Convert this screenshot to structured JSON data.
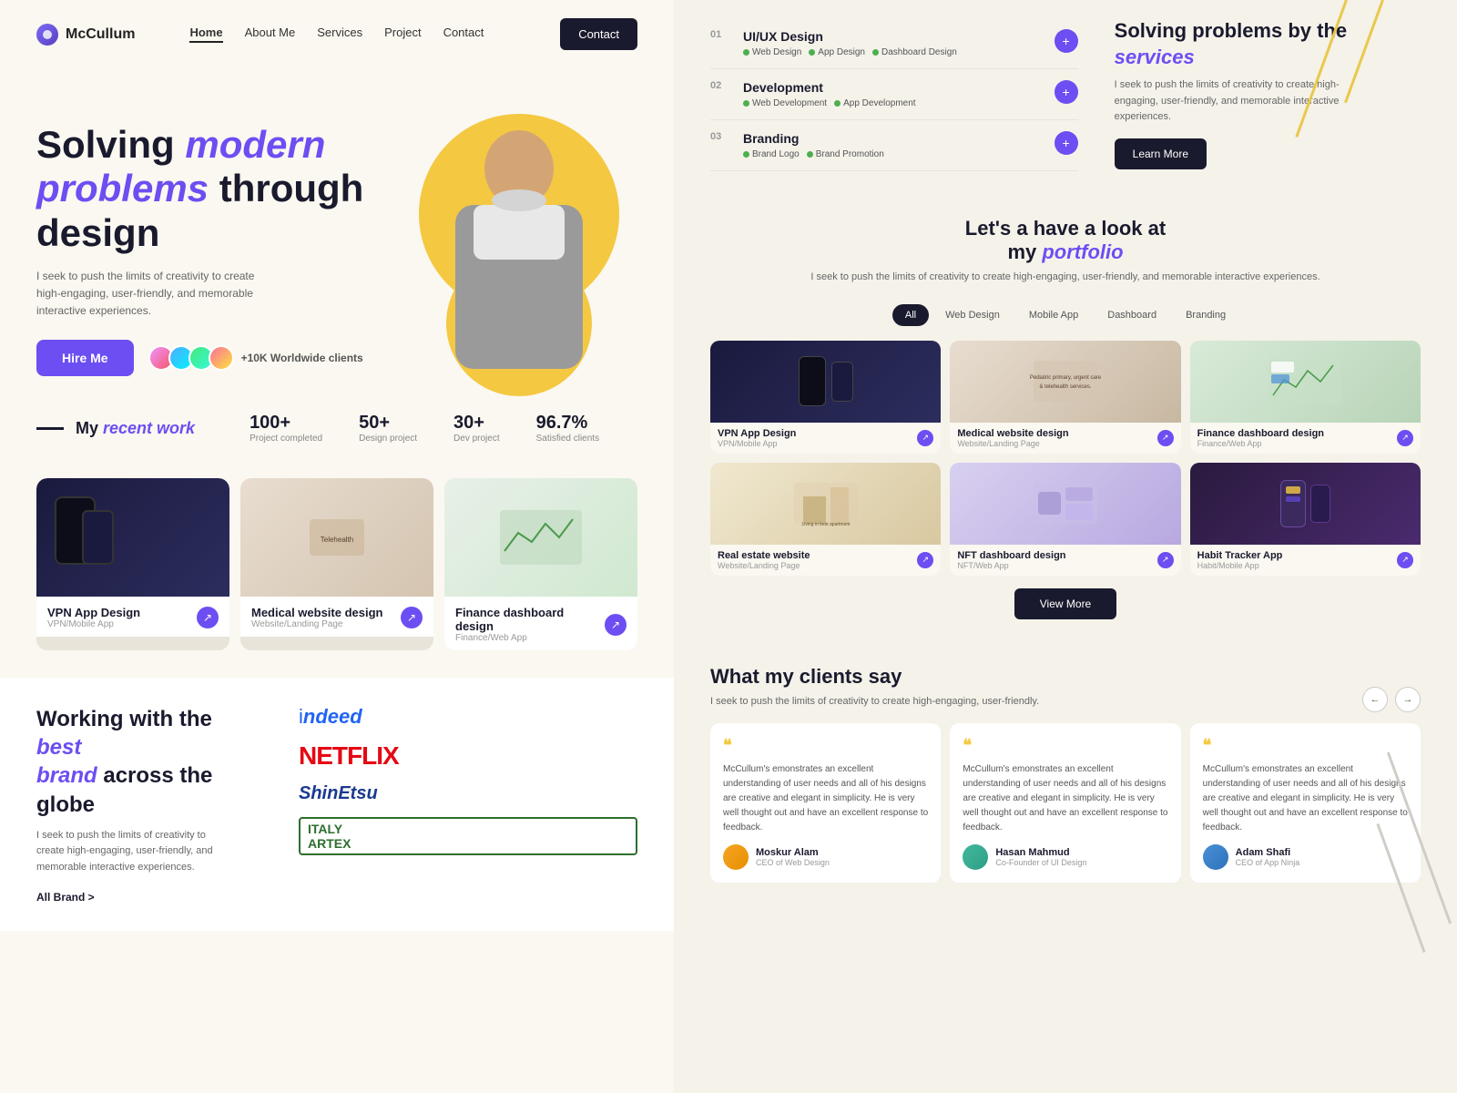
{
  "brand": {
    "logo_text": "McCullum",
    "logo_icon": "●"
  },
  "nav": {
    "links": [
      "Home",
      "About Me",
      "Services",
      "Project",
      "Contact"
    ],
    "active": "Home",
    "cta_label": "Contact"
  },
  "hero": {
    "title_prefix": "Solving ",
    "title_accent": "modern problems",
    "title_suffix": " through design",
    "description": "I seek to push the limits of creativity to create high-engaging, user-friendly, and memorable interactive experiences.",
    "hire_btn": "Hire Me",
    "clients_count": "+10K Worldwide clients"
  },
  "stats": {
    "recent_work_label": "My recent work",
    "items": [
      {
        "num": "100+",
        "label": "Project completed"
      },
      {
        "num": "50+",
        "label": "Design project"
      },
      {
        "num": "30+",
        "label": "Dev project"
      },
      {
        "num": "96.7%",
        "label": "Satisfied clients"
      }
    ]
  },
  "portfolio_cards": [
    {
      "title": "VPN App Design",
      "sub": "VPN/Mobile App",
      "type": "vpn"
    },
    {
      "title": "Medical website design",
      "sub": "Website/Landing Page",
      "type": "medical"
    },
    {
      "title": "Finance dashboard design",
      "sub": "Finance/Web App",
      "type": "finance"
    }
  ],
  "brands": {
    "title_prefix": "Working with the ",
    "title_accent1": "best",
    "title_middle": " ",
    "title_accent2": "brand",
    "title_suffix": " across the globe",
    "description": "I seek to push the limits of creativity to create high-engaging, user-friendly, and memorable interactive experiences.",
    "link": "All Brand >",
    "logos": [
      "indeed",
      "NETFLIX",
      "ShinEtsu",
      "ARTEX"
    ]
  },
  "services": {
    "title_prefix": "Solving problems by the ",
    "title_accent": "services",
    "description": "I seek to push the limits of creativity to create high-engaging, user-friendly, and memorable interactive experiences.",
    "learn_more": "Learn More",
    "items": [
      {
        "num": "01",
        "name": "UI/UX Design",
        "tags": [
          "Web Design",
          "App Design",
          "Dashboard Design"
        ]
      },
      {
        "num": "02",
        "name": "Development",
        "tags": [
          "Web Development",
          "App Development"
        ]
      },
      {
        "num": "03",
        "name": "Branding",
        "tags": [
          "Brand Logo",
          "Brand Promotion"
        ]
      }
    ]
  },
  "portfolio_section": {
    "header_title_prefix": "Let's a have a look at",
    "header_title_line2_prefix": "my ",
    "header_title_accent": "portfolio",
    "description": "I seek to push the limits of creativity to create high-engaging, user-friendly, and memorable interactive experiences.",
    "tabs": [
      "All",
      "Web Design",
      "Mobile App",
      "Dashboard",
      "Branding"
    ],
    "active_tab": "All",
    "cards": [
      {
        "title": "VPN App Design",
        "sub": "VPN/Mobile App",
        "type": "vpn"
      },
      {
        "title": "Medical website design",
        "sub": "Website/Landing Page",
        "type": "medical"
      },
      {
        "title": "Finance dashboard design",
        "sub": "Finance/Web App",
        "type": "finance"
      },
      {
        "title": "Real estate website",
        "sub": "Website/Landing Page",
        "type": "realestate"
      },
      {
        "title": "NFT dashboard design",
        "sub": "NFT/Web App",
        "type": "nft"
      },
      {
        "title": "Habit Tracker App",
        "sub": "Habit/Mobile App",
        "type": "habit"
      }
    ],
    "view_more": "View More"
  },
  "testimonials": {
    "section_title": "What my clients say",
    "section_desc": "I seek to push the limits of creativity to create high-engaging, user-friendly.",
    "nav_prev": "←",
    "nav_next": "→",
    "cards": [
      {
        "quote": "❝",
        "text": "McCullum's emonstrates an excellent understanding of user needs and all of his designs are creative and elegant in simplicity. He is very well thought out and have an excellent response to feedback.",
        "author_name": "Moskur Alam",
        "author_role": "CEO of Web Design",
        "avatar_type": "orange"
      },
      {
        "quote": "❝",
        "text": "McCullum's emonstrates an excellent understanding of user needs and all of his designs are creative and elegant in simplicity. He is very well thought out and have an excellent response to feedback.",
        "author_name": "Hasan Mahmud",
        "author_role": "Co-Founder of UI Design",
        "avatar_type": "teal"
      },
      {
        "quote": "❝",
        "text": "McCullum's emonstrates an excellent understanding of user needs and all of his designs are creative and elegant in simplicity. He is very well thought out and have an excellent response to feedback.",
        "author_name": "Adam Shafi",
        "author_role": "CEO of App Ninja",
        "avatar_type": "blue"
      }
    ]
  }
}
